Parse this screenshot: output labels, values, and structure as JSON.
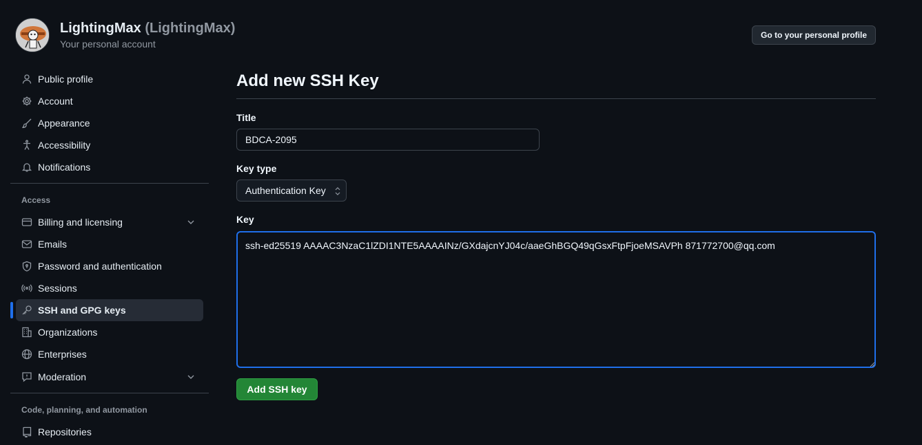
{
  "header": {
    "display_name": "LightingMax",
    "login": "(LightingMax)",
    "subtitle": "Your personal account",
    "profile_button": "Go to your personal profile"
  },
  "sidebar": {
    "items": [
      {
        "label": "Public profile",
        "icon": "person-icon"
      },
      {
        "label": "Account",
        "icon": "gear-icon"
      },
      {
        "label": "Appearance",
        "icon": "paintbrush-icon"
      },
      {
        "label": "Accessibility",
        "icon": "accessibility-icon"
      },
      {
        "label": "Notifications",
        "icon": "bell-icon"
      }
    ],
    "access_label": "Access",
    "access_items": [
      {
        "label": "Billing and licensing",
        "icon": "credit-card-icon",
        "expandable": true
      },
      {
        "label": "Emails",
        "icon": "mail-icon"
      },
      {
        "label": "Password and authentication",
        "icon": "shield-lock-icon"
      },
      {
        "label": "Sessions",
        "icon": "broadcast-icon"
      },
      {
        "label": "SSH and GPG keys",
        "icon": "key-icon",
        "active": true
      },
      {
        "label": "Organizations",
        "icon": "organization-icon"
      },
      {
        "label": "Enterprises",
        "icon": "globe-icon"
      },
      {
        "label": "Moderation",
        "icon": "report-icon",
        "expandable": true
      }
    ],
    "code_label": "Code, planning, and automation",
    "code_items": [
      {
        "label": "Repositories",
        "icon": "repo-icon"
      }
    ]
  },
  "form": {
    "heading": "Add new SSH Key",
    "title_label": "Title",
    "title_value": "BDCA-2095",
    "key_type_label": "Key type",
    "key_type_value": "Authentication Key",
    "key_label": "Key",
    "key_value": "ssh-ed25519 AAAAC3NzaC1lZDI1NTE5AAAAINz/GXdajcnYJ04c/aaeGhBGQ49qGsxFtpFjoeMSAVPh 871772700@qq.com",
    "submit_label": "Add SSH key"
  },
  "colors": {
    "background": "#0d1117",
    "accent": "#1f6feb",
    "primary_button": "#238636"
  }
}
